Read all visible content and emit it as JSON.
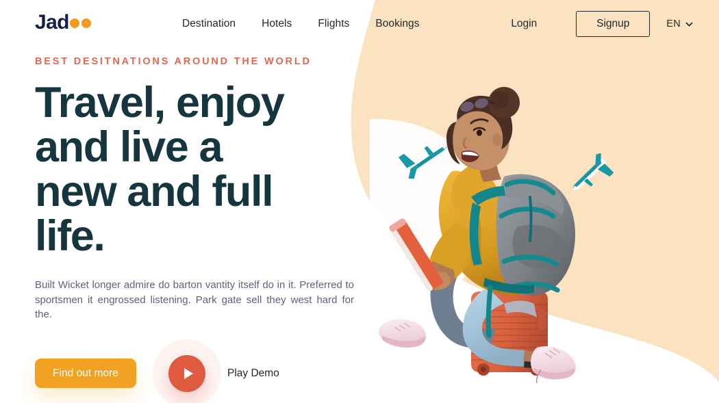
{
  "brand": {
    "name_prefix": "Jad",
    "name_suffix": "oo",
    "logo_dot_color": "#F19A1D",
    "logo_text_color": "#181E4B"
  },
  "nav": {
    "links": [
      {
        "label": "Destination",
        "name": "nav-link-destination"
      },
      {
        "label": "Hotels",
        "name": "nav-link-hotels"
      },
      {
        "label": "Flights",
        "name": "nav-link-flights"
      },
      {
        "label": "Bookings",
        "name": "nav-link-bookings"
      }
    ],
    "login_label": "Login",
    "signup_label": "Signup",
    "language": "EN",
    "language_icon": "chevron-down-icon"
  },
  "hero": {
    "eyebrow": "BEST DESITNATIONS AROUND THE WORLD",
    "eyebrow_color": "#DF6951",
    "title_lines": [
      "Travel, enjoy",
      "and live a",
      "new and full",
      "life."
    ],
    "title_color": "#15353F",
    "description": "Built Wicket longer admire do barton vantity itself do in it. Preferred to sportsmen it engrossed listening. Park gate sell they",
    "description_last_line": "west hard for the.",
    "description_color": "#5E6282",
    "primary_cta": "Find out more",
    "primary_cta_color": "#F1A222",
    "play_label": "Play Demo",
    "play_icon": "play-triangle-icon",
    "play_button_color": "#DF5B3F"
  },
  "decoration": {
    "blob_color": "#FBE2C0",
    "background_color": "#FFFFFF",
    "illustration_alt": "woman-with-backpack-sitting-on-suitcase",
    "plane_color": "#1898A8",
    "suitcase_color": "#DE6A4C",
    "hoodie_color": "#E8AE2E"
  }
}
